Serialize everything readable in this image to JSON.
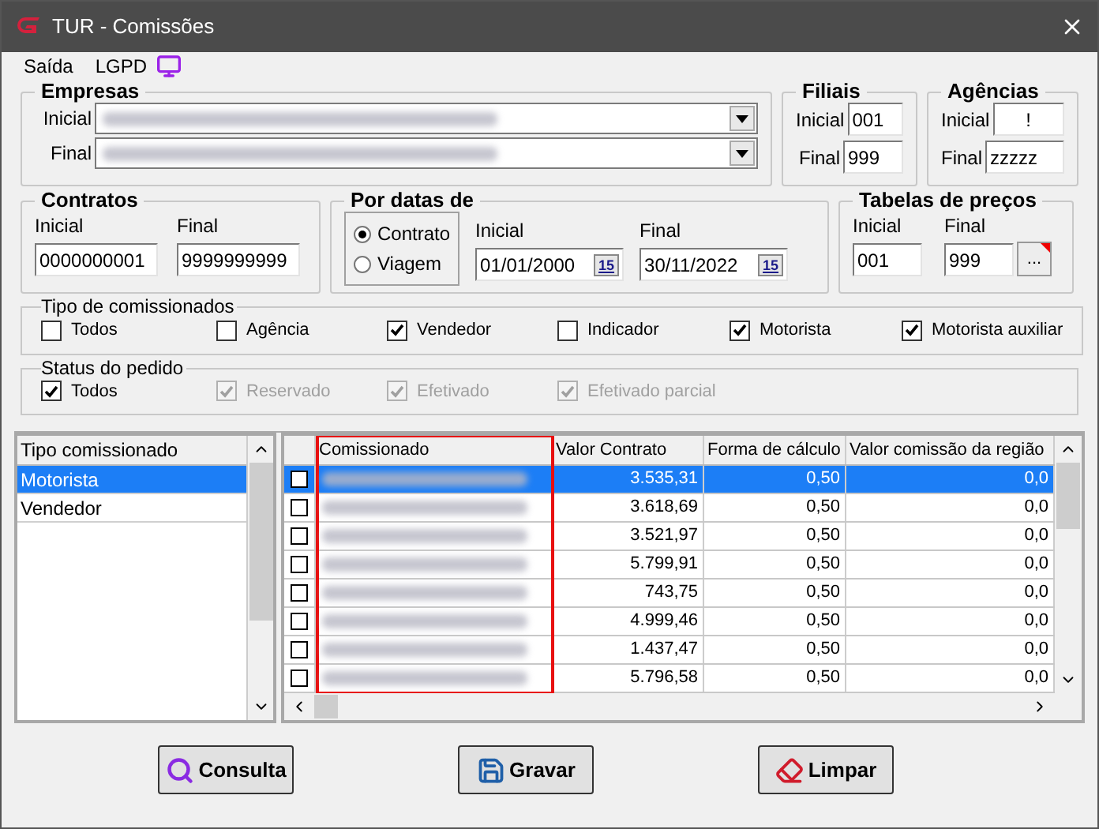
{
  "window": {
    "title": "TUR - Comissões"
  },
  "menu": [
    {
      "label": "Saída",
      "kind": "text"
    },
    {
      "label": "LGPD",
      "kind": "text"
    },
    {
      "kind": "monitor"
    }
  ],
  "empresas": {
    "title": "Empresas",
    "fields": [
      {
        "label": "Inicial"
      },
      {
        "label": "Final"
      }
    ]
  },
  "filiais": {
    "title": "Filiais",
    "fields": [
      {
        "label": "Inicial",
        "value": "001"
      },
      {
        "label": "Final",
        "value": "999"
      }
    ]
  },
  "agencias": {
    "title": "Agências",
    "fields": [
      {
        "label": "Inicial",
        "value": "!"
      },
      {
        "label": "Final",
        "value": "zzzzz"
      }
    ]
  },
  "contratos": {
    "title": "Contratos",
    "fields": [
      {
        "label": "Inicial",
        "value": "0000000001"
      },
      {
        "label": "Final",
        "value": "9999999999"
      }
    ]
  },
  "por_datas": {
    "title": "Por datas de",
    "options": [
      {
        "label": "Contrato",
        "selected": true
      },
      {
        "label": "Viagem",
        "selected": false
      }
    ],
    "fields": [
      {
        "label": "Inicial",
        "value": "01/01/2000",
        "button": "15"
      },
      {
        "label": "Final",
        "value": "30/11/2022",
        "button": "15"
      }
    ]
  },
  "tabelas": {
    "title": "Tabelas de preços",
    "fields": [
      {
        "label": "Inicial",
        "value": "001"
      },
      {
        "label": "Final",
        "value": "999"
      }
    ],
    "button": "..."
  },
  "tipo_comissionados": {
    "title": "Tipo de comissionados",
    "items": [
      {
        "label": "Todos",
        "checked": false,
        "disabled": false
      },
      {
        "label": "Agência",
        "checked": false,
        "disabled": false
      },
      {
        "label": "Vendedor",
        "checked": true,
        "disabled": false
      },
      {
        "label": "Indicador",
        "checked": false,
        "disabled": false
      },
      {
        "label": "Motorista",
        "checked": true,
        "disabled": false
      },
      {
        "label": "Motorista auxiliar",
        "checked": true,
        "disabled": false
      }
    ]
  },
  "status_pedido": {
    "title": "Status do pedido",
    "items": [
      {
        "label": "Todos",
        "checked": true,
        "disabled": false
      },
      {
        "label": "Reservado",
        "checked": true,
        "disabled": true
      },
      {
        "label": "Efetivado",
        "checked": true,
        "disabled": true
      },
      {
        "label": "Efetivado parcial",
        "checked": true,
        "disabled": true
      }
    ]
  },
  "tipo_list": {
    "header": "Tipo comissionado",
    "items": [
      {
        "label": "Motorista",
        "selected": true
      },
      {
        "label": "Vendedor",
        "selected": false
      }
    ]
  },
  "grid": {
    "columns": [
      {
        "label": "Comissionado",
        "highlighted": true
      },
      {
        "label": "Valor Contrato",
        "highlighted": false
      },
      {
        "label": "Forma de cálculo",
        "highlighted": false
      },
      {
        "label": "Valor comissão da região",
        "highlighted": false
      }
    ],
    "rows": [
      {
        "selected": true,
        "checked": false,
        "valor": "3.535,31",
        "forma": "0,50",
        "comissao": "0,0"
      },
      {
        "selected": false,
        "checked": false,
        "valor": "3.618,69",
        "forma": "0,50",
        "comissao": "0,0"
      },
      {
        "selected": false,
        "checked": false,
        "valor": "3.521,97",
        "forma": "0,50",
        "comissao": "0,0"
      },
      {
        "selected": false,
        "checked": false,
        "valor": "5.799,91",
        "forma": "0,50",
        "comissao": "0,0"
      },
      {
        "selected": false,
        "checked": false,
        "valor": "743,75",
        "forma": "0,50",
        "comissao": "0,0"
      },
      {
        "selected": false,
        "checked": false,
        "valor": "4.999,46",
        "forma": "0,50",
        "comissao": "0,0"
      },
      {
        "selected": false,
        "checked": false,
        "valor": "1.437,47",
        "forma": "0,50",
        "comissao": "0,0"
      },
      {
        "selected": false,
        "checked": false,
        "valor": "5.796,58",
        "forma": "0,50",
        "comissao": "0,0"
      }
    ]
  },
  "buttons": [
    {
      "label": "Consulta",
      "kind": "search"
    },
    {
      "label": "Gravar",
      "kind": "save"
    },
    {
      "label": "Limpar",
      "kind": "clear"
    }
  ]
}
